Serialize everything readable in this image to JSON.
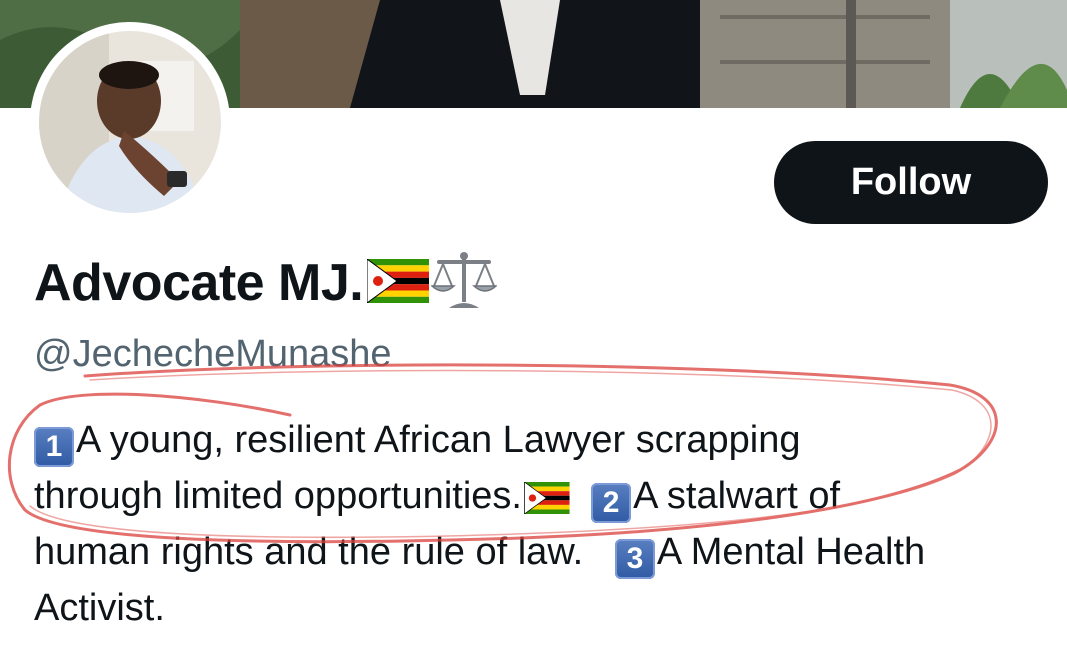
{
  "profile": {
    "display_name": "Advocate MJ.",
    "handle": "@JechecheMunashe",
    "follow_label": "Follow",
    "bio_items": [
      {
        "number": "1",
        "line_a": "A young, resilient African Lawyer scrapping",
        "line_b": "through limited opportunities."
      },
      {
        "number": "2",
        "line_a": "A stalwart of",
        "line_b": "human rights and the rule of law."
      },
      {
        "number": "3",
        "line_a": "A Mental Health",
        "line_b": "Activist."
      }
    ]
  },
  "icons": {
    "name_emojis": [
      "zimbabwe-flag-icon",
      "balance-scale-icon"
    ],
    "bio_emojis": [
      "keycap-1-icon",
      "zimbabwe-flag-icon",
      "keycap-2-icon",
      "keycap-3-icon"
    ]
  },
  "colors": {
    "follow_bg": "#0f1419",
    "follow_text": "#ffffff",
    "handle": "#536471",
    "keycap": "#3b65b0",
    "annotation": "#d9403b"
  }
}
